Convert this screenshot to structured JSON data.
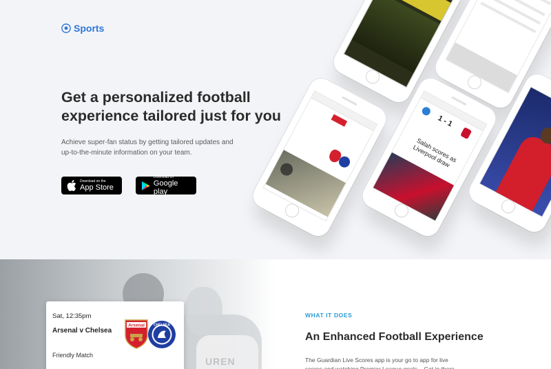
{
  "brand": {
    "name": "Sports"
  },
  "hero": {
    "headline": "Get a personalized football experience tailored just for you",
    "subtext": "Achieve super-fan status by getting tailored updates and up-to-the-minute information on your team.",
    "badges": {
      "apple": {
        "small": "Download on the",
        "large": "App Store"
      },
      "google": {
        "small": "Download on",
        "large": "Google play"
      }
    }
  },
  "phones": {
    "score": "1 - 1",
    "headline": "Salah scores as Liverpool draw"
  },
  "match_card": {
    "time": "Sat, 12:35pm",
    "teams": "Arsenal v Chelsea",
    "type": "Friendly Match",
    "home_crest_text": "Arsenal",
    "away_crest_text": "CHELSEA"
  },
  "section": {
    "eyebrow": "WHAT IT DOES",
    "title": "An Enhanced Football Experience",
    "body": "The Guardian Live Scores app is your go to app for live scores and watching Premier League goals... Get in there"
  },
  "colors": {
    "accent": "#2f76d8",
    "eyebrow": "#2a9bd6",
    "arsenal_red": "#d4202d",
    "chelsea_blue": "#1f3ea1"
  }
}
